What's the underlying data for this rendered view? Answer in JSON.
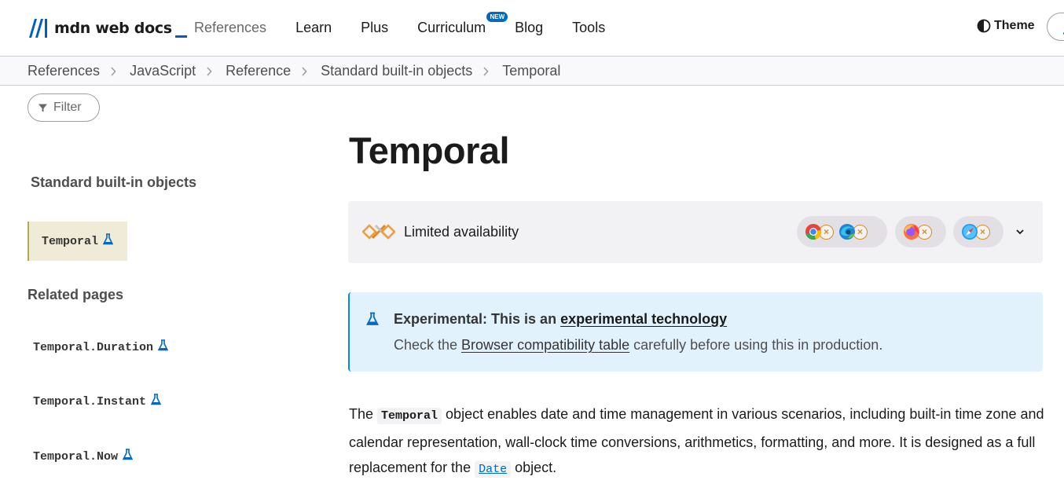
{
  "header": {
    "logo_text": "mdn web docs",
    "nav": [
      {
        "label": "References"
      },
      {
        "label": "Learn"
      },
      {
        "label": "Plus"
      },
      {
        "label": "Curriculum",
        "badge": "NEW"
      },
      {
        "label": "Blog"
      },
      {
        "label": "Tools"
      }
    ],
    "theme_label": "Theme"
  },
  "breadcrumb": [
    "References",
    "JavaScript",
    "Reference",
    "Standard built-in objects",
    "Temporal"
  ],
  "sidebar": {
    "filter_placeholder": "Filter",
    "section_heading": "Standard built-in objects",
    "current_item": "Temporal",
    "related_heading": "Related pages",
    "related": [
      "Temporal.Duration",
      "Temporal.Instant",
      "Temporal.Now"
    ]
  },
  "main": {
    "title": "Temporal",
    "availability": {
      "label": "Limited availability",
      "browsers": [
        "chrome-icon",
        "edge-icon",
        "firefox-icon",
        "safari-icon"
      ],
      "status": "unsupported"
    },
    "experimental": {
      "prefix": "Experimental: This is an ",
      "link": "experimental technology",
      "line2_prefix": "Check the ",
      "line2_link": "Browser compatibility table",
      "line2_suffix": " carefully before using this in production."
    },
    "description": {
      "p1": "The ",
      "code1": "Temporal",
      "p2": " object enables date and time management in various scenarios, including built-in time zone and calendar representation, wall-clock time conversions, arithmetics, formatting, and more. It is designed as a full replacement for the ",
      "code2": "Date",
      "p3": " object."
    }
  },
  "colors": {
    "accent": "#0069c2",
    "warning": "#d39020",
    "sidebar_current_bg": "#efebd7",
    "experimental_bg": "#e2f2fd"
  }
}
